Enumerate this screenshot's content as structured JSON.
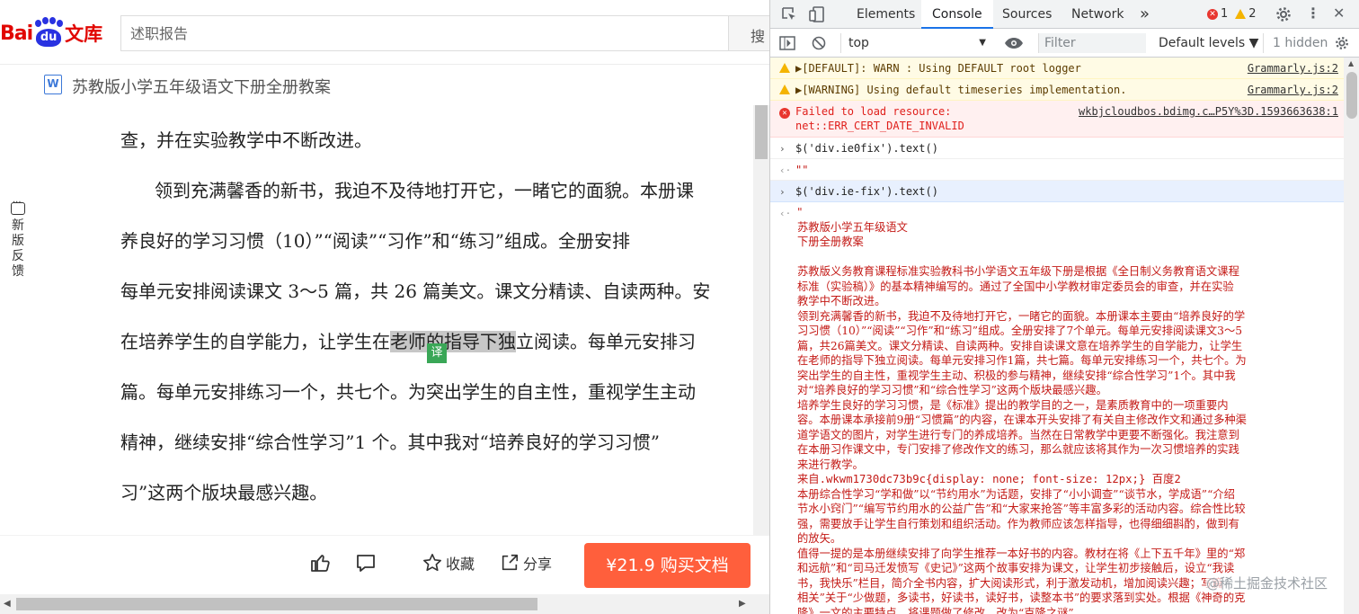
{
  "baidu": {
    "logo_bai": "Bai",
    "logo_du": "du",
    "logo_wenku": "文库",
    "search_placeholder": "述职报告",
    "search_btn_char": "搜"
  },
  "doc": {
    "icon_letter": "W",
    "title": "苏教版小学五年级语文下册全册教案",
    "feedback_chars": [
      "新",
      "版",
      "反",
      "馈"
    ],
    "lines": [
      "查，并在实验教学中不断改进。",
      "领到充满馨香的新书，我迫不及待地打开它，一睹它的面貌。本册课",
      "养良好的学习习惯（10）”“阅读”“习作”和“练习”组成。全册安排",
      "每单元安排阅读课文 3～5 篇，共 26 篇美文。课文分精读、自读两种。安",
      "在培养学生的自学能力，让学生在",
      "老师的指导下独",
      "立阅读。每单元安排习",
      "篇。每单元安排练习一个，共七个。为突出学生的自主性，重视学生主动",
      "精神，继续安排“综合性学习”1 个。其中我对“培养良好的学习习惯”",
      "习”这两个版块最感兴趣。"
    ],
    "translate_badge": "译"
  },
  "toolbar": {
    "collect": "收藏",
    "share": "分享",
    "buy": "¥21.9 购买文档"
  },
  "devtools": {
    "tabs": [
      "Elements",
      "Console",
      "Sources",
      "Network"
    ],
    "more": "»",
    "error_count": "1",
    "warn_count": "2",
    "context": "top",
    "filter_placeholder": "Filter",
    "levels": "Default levels ▼",
    "hidden": "1 hidden",
    "messages": [
      {
        "type": "warn",
        "text": "▶[DEFAULT]: WARN : Using DEFAULT root logger",
        "src": "Grammarly.js:2"
      },
      {
        "type": "warn",
        "text": "▶[WARNING] Using default timeseries implementation.",
        "src": "Grammarly.js:2"
      },
      {
        "type": "error",
        "text": "Failed to load resource:",
        "text2": "net::ERR_CERT_DATE_INVALID",
        "src": "wkbjcloudbos.bdimg.c…P5Y%3D.1593663638:1"
      },
      {
        "type": "input",
        "text": "$('div.ie0fix').text()"
      },
      {
        "type": "output",
        "text": "\"\""
      },
      {
        "type": "input",
        "text": "$('div.ie-fix').text()"
      }
    ],
    "output_lines": [
      "\"",
      "苏教版小学五年级语文",
      "下册全册教案",
      "",
      "苏教版义务教育课程标准实验教科书小学语文五年级下册是根据《全日制义务教育语文课程",
      "标准（实验稿）》的基本精神编写的。通过了全国中小学教材审定委员会的审查，并在实验",
      "教学中不断改进。",
      "领到充满馨香的新书，我迫不及待地打开它，一睹它的面貌。本册课本主要由“培养良好的学",
      "习习惯（10）”“阅读”“习作”和“练习”组成。全册安排了7个单元。每单元安排阅读课文3～5",
      "篇，共26篇美文。课文分精读、自读两种。安排自读课文意在培养学生的自学能力，让学生",
      "在老师的指导下独立阅读。每单元安排习作1篇，共七篇。每单元安排练习一个，共七个。为",
      "突出学生的自主性，重视学生主动、积极的参与精神，继续安排“综合性学习”1个。其中我",
      "对“培养良好的学习习惯”和“综合性学习”这两个版块最感兴趣。",
      "培养学生良好的学习习惯，是《标准》提出的教学目的之一，是素质教育中的一项重要内",
      "容。本册课本承接前9册“习惯篇”的内容，在课本开头安排了有关自主修改作文和通过多种渠",
      "道学语文的图片，对学生进行专门的养成培养。当然在日常教学中更要不断强化。我注意到",
      "在本册习作课文中，专门安排了修改作文的练习，那么就应该将其作为一次习惯培养的实践",
      "来进行教学。",
      "来自.wkwm1730dc73b9c{display: none; font-size: 12px;} 百度2",
      "本册综合性学习“学和做”以“节约用水”为话题，安排了“小小调查”“谈节水，学成语”“介绍",
      "节水小窍门”“编写节约用水的公益广告”和“大家来抢答”等丰富多彩的活动内容。综合性比较",
      "强，需要放手让学生自行策划和组织活动。作为教师应该怎样指导，也得细细斟酌，做到有",
      "的放矢。",
      "值得一提的是本册继续安排了向学生推荐一本好书的内容。教材在将《上下五千年》里的“郑",
      "和远航”和“司马迁发愤写《史记》”这两个故事安排为课文，让学生初步接触后，设立“我读",
      "书，我快乐”栏目，简介全书内容，扩大阅读形式，利于激发动机，增加阅读兴趣；写篇",
      "相关”关于“少做题，多读书，好读书，读好书，读整本书”的要求落到实处。根据《神奇的克",
      "隆》一文的主要特点，将课题做了修改，改为“克隆之谜”"
    ],
    "watermark": "@稀土掘金技术社区"
  }
}
